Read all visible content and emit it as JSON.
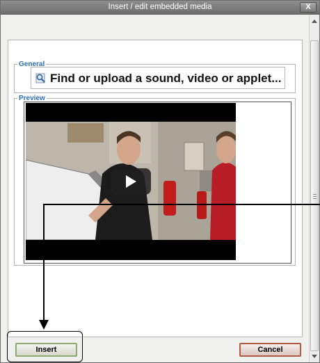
{
  "dialog": {
    "title": "Insert / edit embedded media",
    "close_label": "X"
  },
  "general": {
    "legend": "General",
    "url_text": "Find or upload a sound, video or applet..."
  },
  "preview": {
    "legend": "Preview"
  },
  "buttons": {
    "insert_label": "Insert",
    "cancel_label": "Cancel"
  },
  "colors": {
    "titlebar": "#7e7e7e",
    "legend": "#2b6fb6",
    "insert_border": "#8fa96e",
    "cancel_border": "#b55b45"
  },
  "icons": {
    "search": "magnifier-icon",
    "play": "play-icon"
  }
}
